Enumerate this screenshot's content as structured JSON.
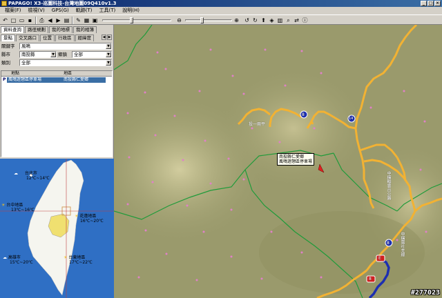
{
  "window": {
    "title": "PAPAGO! X3-巡圖科技-台灣地圖09Q410v1.3"
  },
  "menu": [
    "檔案(F)",
    "檢視(V)",
    "GPS(G)",
    "軌跡(T)",
    "工具(T)",
    "說明(H)"
  ],
  "tabs_row1": [
    "資料查詢",
    "路徑規劃",
    "我的地標",
    "我的相簿"
  ],
  "tabs_row2": [
    "景點",
    "交叉路口",
    "位置",
    "行政區",
    "經緯度"
  ],
  "form": {
    "keyword_label": "關鍵字",
    "keyword_value": "風鳴",
    "city_label": "縣市",
    "city_value": "南投縣",
    "town_label": "鄉鎮",
    "town_value": "全部",
    "category_label": "類別",
    "category_value": "全部"
  },
  "results": {
    "columns": [
      "地點",
      "地區"
    ],
    "rows": [
      {
        "icon": "P",
        "name": "風鳴遊憩區停車場",
        "area": "南投縣仁愛鄉"
      }
    ]
  },
  "weather": [
    {
      "city": "台北市",
      "temp": "12℃~14℃",
      "icon": "cloud-icon"
    },
    {
      "city": "台中地區",
      "temp": "13℃~16℃",
      "icon": "sun-cloud-icon"
    },
    {
      "city": "花蓮地區",
      "temp": "16℃~20℃",
      "icon": "sun-cloud-icon"
    },
    {
      "city": "高雄市",
      "temp": "15℃~20℃",
      "icon": "cloud-icon"
    },
    {
      "city": "台東地區",
      "temp": "17℃~22℃",
      "icon": "sun-cloud-icon"
    }
  ],
  "map": {
    "poi_label_line1": "南投縣仁愛鄉",
    "poi_label_line2": "風鳴遊憩區停車場",
    "road_label_1": "投一兩平",
    "road_label_2": "中橫輸雲台公路",
    "road_label_3": "中橫霧社支線",
    "shield_1": "8",
    "shield_2": "14",
    "shield_3": "E",
    "shield_4": "8",
    "shield_5": "8",
    "watermark": "#277023"
  },
  "colors": {
    "highway": "#f2b233",
    "boundary": "#1f9b3a",
    "route": "#1d2fb0",
    "terrain": "#9a9a6c",
    "sea": "#2f6fc4"
  }
}
